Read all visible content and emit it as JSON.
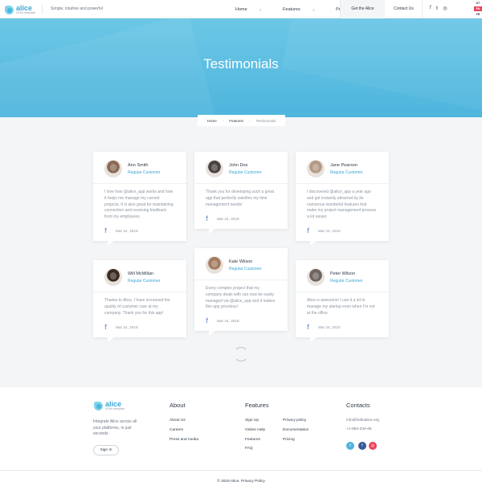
{
  "header": {
    "logo_name": "alice",
    "logo_sub": "HTML template",
    "tagline": "Simple, intuitive and powerful",
    "nav": [
      {
        "label": "Home",
        "caret": "⌄"
      },
      {
        "label": "Features",
        "caret": "⌄"
      },
      {
        "label": "Pricing",
        "caret": ""
      }
    ],
    "get_label": "Get the Alice",
    "contact_label": "Contact Us",
    "socials": [
      "f",
      "𝕥",
      "◎"
    ],
    "langs": [
      "DT",
      "EN",
      "FR"
    ]
  },
  "hero": {
    "title": "Testimonials"
  },
  "breadcrumb": {
    "home": "Home",
    "features": "Features",
    "current": "Testimonials",
    "sep": "›"
  },
  "testimonials": [
    {
      "name": "Ann Smith",
      "role": "Regular Customer",
      "text": "I love how @alice_app works and how it helps me manage my current projects. It is also great for maintaining connection and receiving feedback from my employees.",
      "date": "Mar 24, 2018",
      "avatar_color": "#8a6a55"
    },
    {
      "name": "John Doe",
      "role": "Regular Customer",
      "text": "Thank you for developing such a great app that perfectly satisfies my time management needs!",
      "date": "Mar 24, 2018",
      "avatar_color": "#4a4240"
    },
    {
      "name": "Jane Pearson",
      "role": "Regular Customer",
      "text": "I discovered @alice_app a year ago and got instantly attracted by its numerous wonderful features that make my project management process a lot easier.",
      "date": "Mar 24, 2018",
      "avatar_color": "#b39a84"
    },
    {
      "name": "Will McMillan",
      "role": "Regular Customer",
      "text": "Thanks to Alice, I have increased the quality of customer care at my company. Thank you for this app!",
      "date": "Mar 24, 2018",
      "avatar_color": "#3d2c24"
    },
    {
      "name": "Kate Wilson",
      "role": "Regular Customer",
      "text": "Every complex project that my company deals with can now be easily managed via @alice_app and it makes this app priceless!",
      "date": "Mar 24, 2018",
      "avatar_color": "#a37c5f"
    },
    {
      "name": "Peter Wilson",
      "role": "Regular Customer",
      "text": "Alice is awesome! I use it a lot to manage my startup even when I'm not at the office.",
      "date": "Mar 24, 2018",
      "avatar_color": "#6f6460"
    }
  ],
  "footer": {
    "logo_name": "alice",
    "logo_sub": "HTML template",
    "description": "Integrate Alice across all your platforms, in just seconds",
    "signin": "Sign In",
    "about_title": "About",
    "about_links": [
      "About Us",
      "Careers",
      "Press and media"
    ],
    "features_title": "Features",
    "features_links": [
      "Sign Up",
      "Online Help",
      "Features",
      "FAQ"
    ],
    "features_links2": [
      "Privacy policy",
      "Documentation",
      "Pricing"
    ],
    "contacts_title": "Contacts",
    "email": "info@helloalice.org",
    "phone": "+1-853-234-65",
    "social": [
      {
        "icon": "𝕥",
        "color": "#4fb3e0"
      },
      {
        "icon": "f",
        "color": "#3b5998"
      },
      {
        "icon": "◎",
        "color": "#e9445a"
      }
    ],
    "copyright": "© 2018 Alice. Privacy Policy"
  }
}
